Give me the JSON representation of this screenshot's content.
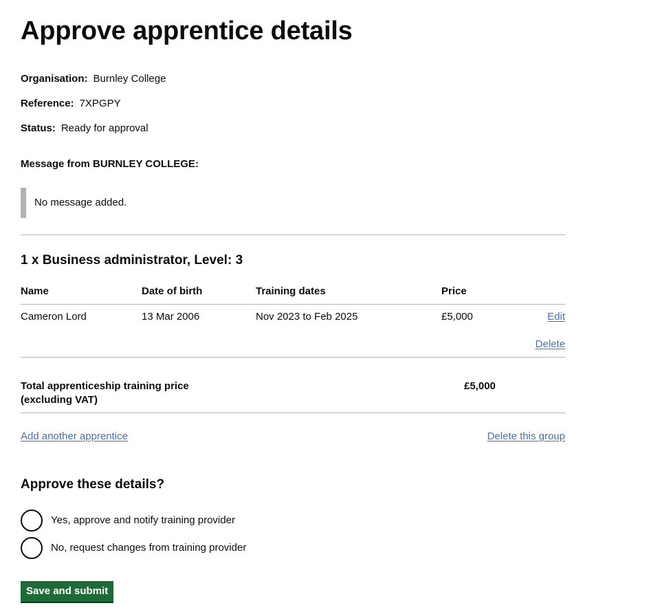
{
  "page": {
    "title": "Approve apprentice details"
  },
  "summary": {
    "organisation": {
      "label": "Organisation:",
      "value": "Burnley College"
    },
    "reference": {
      "label": "Reference:",
      "value": "7XPGPY"
    },
    "status": {
      "label": "Status:",
      "value": "Ready for approval"
    }
  },
  "message": {
    "heading": "Message from BURNLEY COLLEGE:",
    "body": "No message added."
  },
  "group": {
    "heading": "1 x Business administrator, Level: 3",
    "columns": {
      "name": "Name",
      "dob": "Date of birth",
      "training": "Training dates",
      "price": "Price"
    },
    "rows": [
      {
        "name": "Cameron Lord",
        "dob": "13 Mar 2006",
        "training": "Nov 2023 to Feb 2025",
        "price": "£5,000",
        "edit_label": "Edit",
        "delete_label": "Delete"
      }
    ],
    "total": {
      "label": "Total apprenticeship training price (excluding VAT)",
      "value": "£5,000"
    },
    "add_link": "Add another apprentice",
    "delete_group_link": "Delete this group"
  },
  "approval": {
    "heading": "Approve these details?",
    "options": [
      {
        "label": "Yes, approve and notify training provider",
        "selected": false
      },
      {
        "label": "No, request changes from training provider",
        "selected": false
      }
    ],
    "submit_label": "Save and submit"
  },
  "colors": {
    "text": "#0b0c0c",
    "link": "#4c6fae",
    "border": "#b1b4b6",
    "button": "#1e6b37"
  }
}
